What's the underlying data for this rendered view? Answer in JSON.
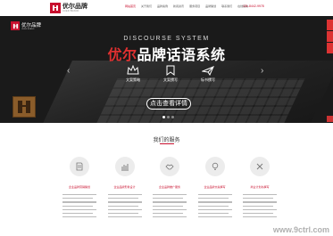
{
  "header": {
    "brand_cn": "优尔品牌",
    "brand_en": "UUER BRAND",
    "nav": [
      "网站首页",
      "关于我们",
      "品牌案例",
      "新闻资讯",
      "服务项目",
      "品牌策划",
      "联系我们",
      "在线留言"
    ],
    "phone": "131-8442-9978"
  },
  "hero": {
    "brand_cn": "优尔品牌",
    "brand_en": "UUER BRAND",
    "en_title": "DISCOURSE SYSTEM",
    "title_accent": "优尔",
    "title_rest": "品牌话语系统",
    "features": [
      {
        "icon": "crown-icon",
        "label": "文案策略"
      },
      {
        "icon": "bookmark-icon",
        "label": "文案撰写"
      },
      {
        "icon": "plane-icon",
        "label": "标书撰写"
      }
    ],
    "cta": "点击查看详情",
    "prev": "‹",
    "next": "›"
  },
  "services": {
    "title": "我们的服务",
    "items": [
      {
        "icon": "document-icon",
        "name": "企业品牌营销策划"
      },
      {
        "icon": "chart-icon",
        "name": "企业品牌形象设计"
      },
      {
        "icon": "handshake-icon",
        "name": "企业品牌推广服务"
      },
      {
        "icon": "bulb-icon",
        "name": "企业品牌文案撰写"
      },
      {
        "icon": "tools-icon",
        "name": "商业计划书撰写"
      }
    ]
  },
  "watermark": "www.9ctrl.com",
  "colors": {
    "accent": "#c8102e",
    "hero_bg": "#1a1a1a"
  }
}
